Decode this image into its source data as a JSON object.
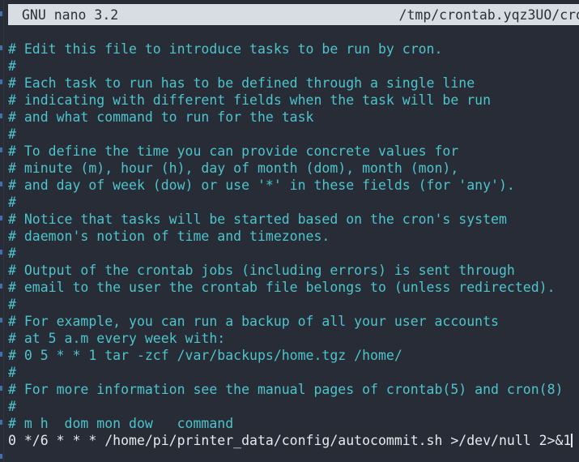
{
  "titlebar": {
    "app_label": "GNU nano 3.2",
    "file_path": "/tmp/crontab.yqz3UO/cro"
  },
  "colors": {
    "terminal_background": "#272c36",
    "titlebar_background": "#d8dce3",
    "titlebar_text": "#2b303a",
    "comment_text": "#4ec4cc",
    "command_text": "#e6e9ee",
    "edge_indicator": "#4a84d6"
  },
  "editor": {
    "lines": [
      {
        "text": "# Edit this file to introduce tasks to be run by cron.",
        "kind": "comment"
      },
      {
        "text": "#",
        "kind": "comment"
      },
      {
        "text": "# Each task to run has to be defined through a single line",
        "kind": "comment"
      },
      {
        "text": "# indicating with different fields when the task will be run",
        "kind": "comment"
      },
      {
        "text": "# and what command to run for the task",
        "kind": "comment"
      },
      {
        "text": "#",
        "kind": "comment"
      },
      {
        "text": "# To define the time you can provide concrete values for",
        "kind": "comment"
      },
      {
        "text": "# minute (m), hour (h), day of month (dom), month (mon),",
        "kind": "comment"
      },
      {
        "text": "# and day of week (dow) or use '*' in these fields (for 'any').",
        "kind": "comment"
      },
      {
        "text": "#",
        "kind": "comment"
      },
      {
        "text": "# Notice that tasks will be started based on the cron's system",
        "kind": "comment"
      },
      {
        "text": "# daemon's notion of time and timezones.",
        "kind": "comment"
      },
      {
        "text": "#",
        "kind": "comment"
      },
      {
        "text": "# Output of the crontab jobs (including errors) is sent through",
        "kind": "comment"
      },
      {
        "text": "# email to the user the crontab file belongs to (unless redirected).",
        "kind": "comment"
      },
      {
        "text": "#",
        "kind": "comment"
      },
      {
        "text": "# For example, you can run a backup of all your user accounts",
        "kind": "comment"
      },
      {
        "text": "# at 5 a.m every week with:",
        "kind": "comment"
      },
      {
        "text": "# 0 5 * * 1 tar -zcf /var/backups/home.tgz /home/",
        "kind": "comment"
      },
      {
        "text": "#",
        "kind": "comment"
      },
      {
        "text": "# For more information see the manual pages of crontab(5) and cron(8)",
        "kind": "comment"
      },
      {
        "text": "#",
        "kind": "comment"
      },
      {
        "text": "# m h  dom mon dow   command",
        "kind": "comment"
      },
      {
        "text": "0 */6 * * * /home/pi/printer_data/config/autocommit.sh >/dev/null 2>&1",
        "kind": "command",
        "cursor_after": true
      }
    ]
  }
}
